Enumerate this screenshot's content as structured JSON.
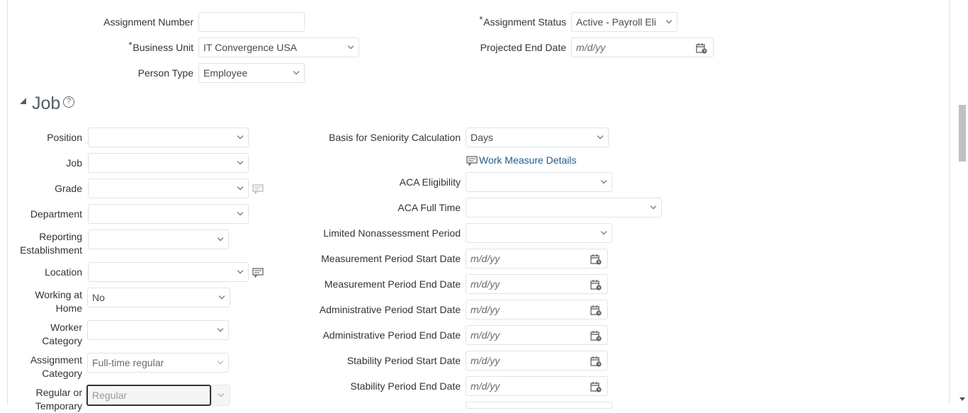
{
  "top": {
    "assignment_number": {
      "label": "Assignment Number",
      "value": ""
    },
    "business_unit": {
      "label": "Business Unit",
      "required": "*",
      "value": "IT Convergence USA"
    },
    "person_type": {
      "label": "Person Type",
      "value": "Employee"
    },
    "assignment_status": {
      "label": "Assignment Status",
      "required": "*",
      "value": "Active - Payroll Eli"
    },
    "projected_end_date": {
      "label": "Projected End Date",
      "placeholder": "m/d/yy"
    }
  },
  "job": {
    "title": "Job",
    "help_glyph": "?",
    "left": {
      "position": {
        "label": "Position",
        "value": ""
      },
      "job": {
        "label": "Job",
        "value": ""
      },
      "grade": {
        "label": "Grade",
        "value": ""
      },
      "department": {
        "label": "Department",
        "value": ""
      },
      "reporting_establishment": {
        "label": "Reporting Establishment",
        "value": ""
      },
      "location": {
        "label": "Location",
        "value": ""
      },
      "working_at_home": {
        "label": "Working at Home",
        "value": "No"
      },
      "worker_category": {
        "label": "Worker Category",
        "value": ""
      },
      "assignment_category": {
        "label": "Assignment Category",
        "value": "Full-time regular"
      },
      "regular_or_temporary": {
        "label": "Regular or Temporary",
        "value": "Regular"
      }
    },
    "right": {
      "basis_for_seniority": {
        "label": "Basis for Seniority Calculation",
        "value": "Days"
      },
      "work_measure_details": {
        "label": "Work Measure Details"
      },
      "aca_eligibility": {
        "label": "ACA Eligibility",
        "value": ""
      },
      "aca_full_time": {
        "label": "ACA Full Time",
        "value": ""
      },
      "limited_nonassessment": {
        "label": "Limited Nonassessment Period",
        "value": ""
      },
      "measurement_start": {
        "label": "Measurement Period Start Date",
        "placeholder": "m/d/yy"
      },
      "measurement_end": {
        "label": "Measurement Period End Date",
        "placeholder": "m/d/yy"
      },
      "administrative_start": {
        "label": "Administrative Period Start Date",
        "placeholder": "m/d/yy"
      },
      "administrative_end": {
        "label": "Administrative Period End Date",
        "placeholder": "m/d/yy"
      },
      "stability_start": {
        "label": "Stability Period Start Date",
        "placeholder": "m/d/yy"
      },
      "stability_end": {
        "label": "Stability Period End Date",
        "placeholder": "m/d/yy"
      }
    }
  },
  "icons": {
    "calendar": "calendar-icon",
    "chevron": "chevron-down-icon",
    "details": "details-icon",
    "help": "help-icon"
  },
  "colors": {
    "link": "#1d5b8c",
    "field_border": "#dfe4e8",
    "label": "#333333",
    "section_title": "#555c63"
  }
}
